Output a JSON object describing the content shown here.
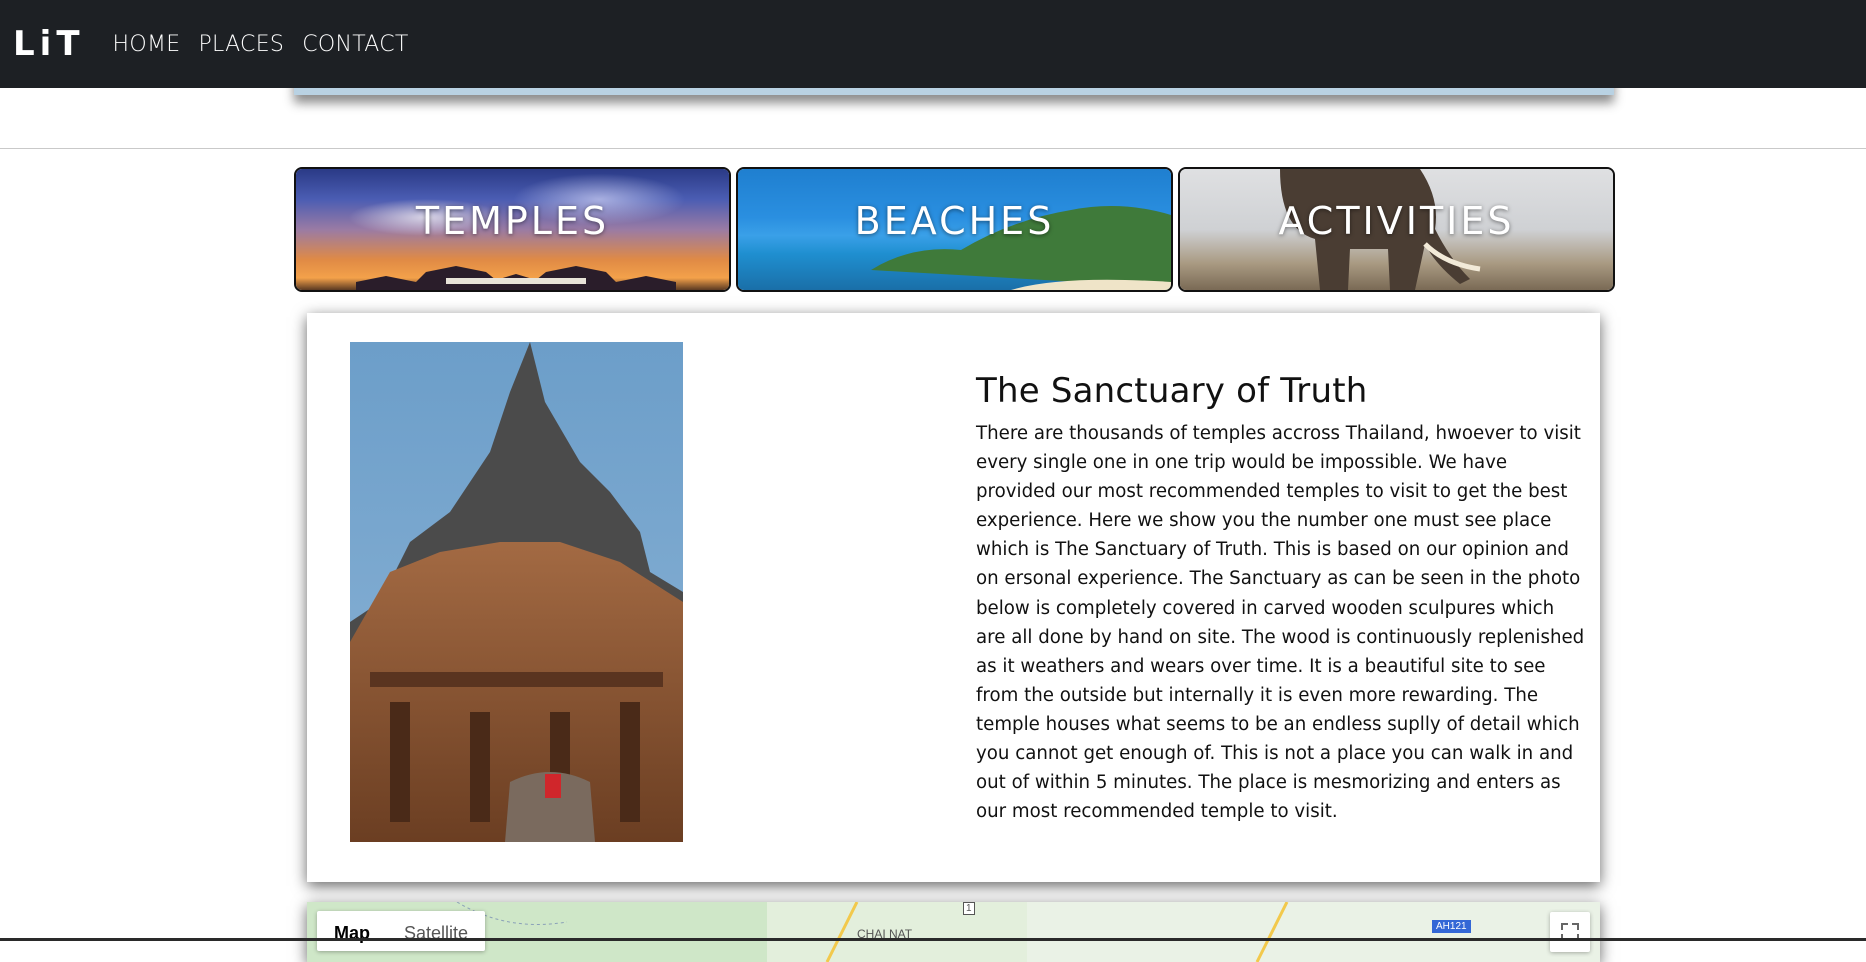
{
  "header": {
    "logo": "LiT",
    "nav": [
      {
        "label": "HOME"
      },
      {
        "label": "PLACES"
      },
      {
        "label": "CONTACT"
      }
    ]
  },
  "categories": [
    {
      "label": "TEMPLES"
    },
    {
      "label": "BEACHES"
    },
    {
      "label": "ACTIVITIES"
    }
  ],
  "feature": {
    "title": "The Sanctuary of Truth",
    "body": "There are thousands of temples accross Thailand, hwoever to visit every single one in one trip would be impossible. We have provided our most recommended temples to visit to get the best experience. Here we show you the number one must see place which is The Sanctuary of Truth. This is based on our opinion and on ersonal experience. The Sanctuary as can be seen in the photo below is completely covered in carved wooden sculpures which are all done by hand on site. The wood is continuously replenished as it weathers and wears over time. It is a beautiful site to see from the outside but internally it is even more rewarding. The temple houses what seems to be an endless suplly of detail which you cannot get enough of. This is not a place you can walk in and out of within 5 minutes. The place is mesmorizing and enters as our most recommended temple to visit."
  },
  "map": {
    "tabs": [
      "Map",
      "Satellite"
    ],
    "place_label": "CHAI NAT",
    "highway_shield": "AH121",
    "road_number": "1"
  },
  "colors": {
    "navbar_bg": "#1d2024",
    "hero_strip": "#b9d2e3"
  }
}
